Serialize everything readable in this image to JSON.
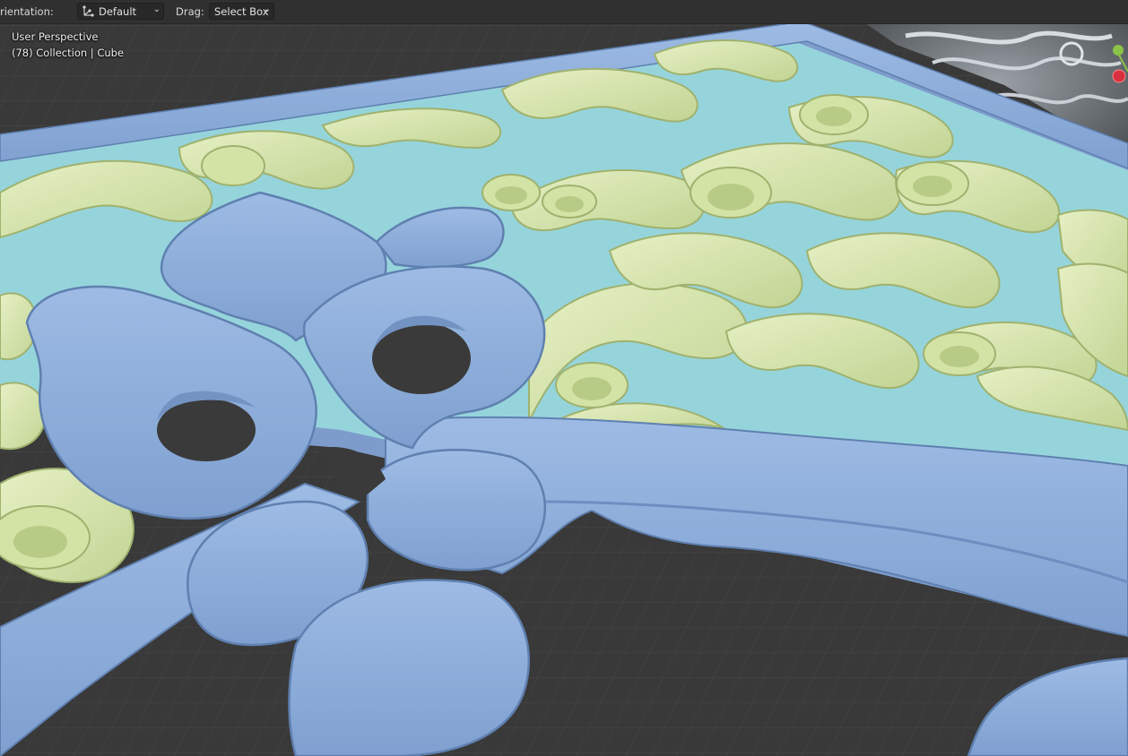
{
  "header": {
    "orientation_label": "rientation:",
    "orientation_value": "Default",
    "drag_label": "Drag:",
    "drag_value": "Select Box"
  },
  "viewport": {
    "perspective_label": "User Perspective",
    "object_info": "(78) Collection | Cube"
  },
  "icons": {
    "orientation": "transform-orientation-icon",
    "dropdown": "chevron-down-icon",
    "gizmo_y": "axis-y-icon",
    "gizmo_x": "axis-x-icon"
  },
  "colors": {
    "ui_bg": "#303030",
    "grid_bg": "#3a3a3a",
    "frame_blue": "#8fb0dc",
    "frame_blue_dark": "#5f80b0",
    "ornament_green": "#d9e8b0",
    "ornament_green_dark": "#a4b978",
    "backing_cyan": "#96d4dc",
    "axis_x": "#d8303e",
    "axis_y": "#8bc34a"
  }
}
